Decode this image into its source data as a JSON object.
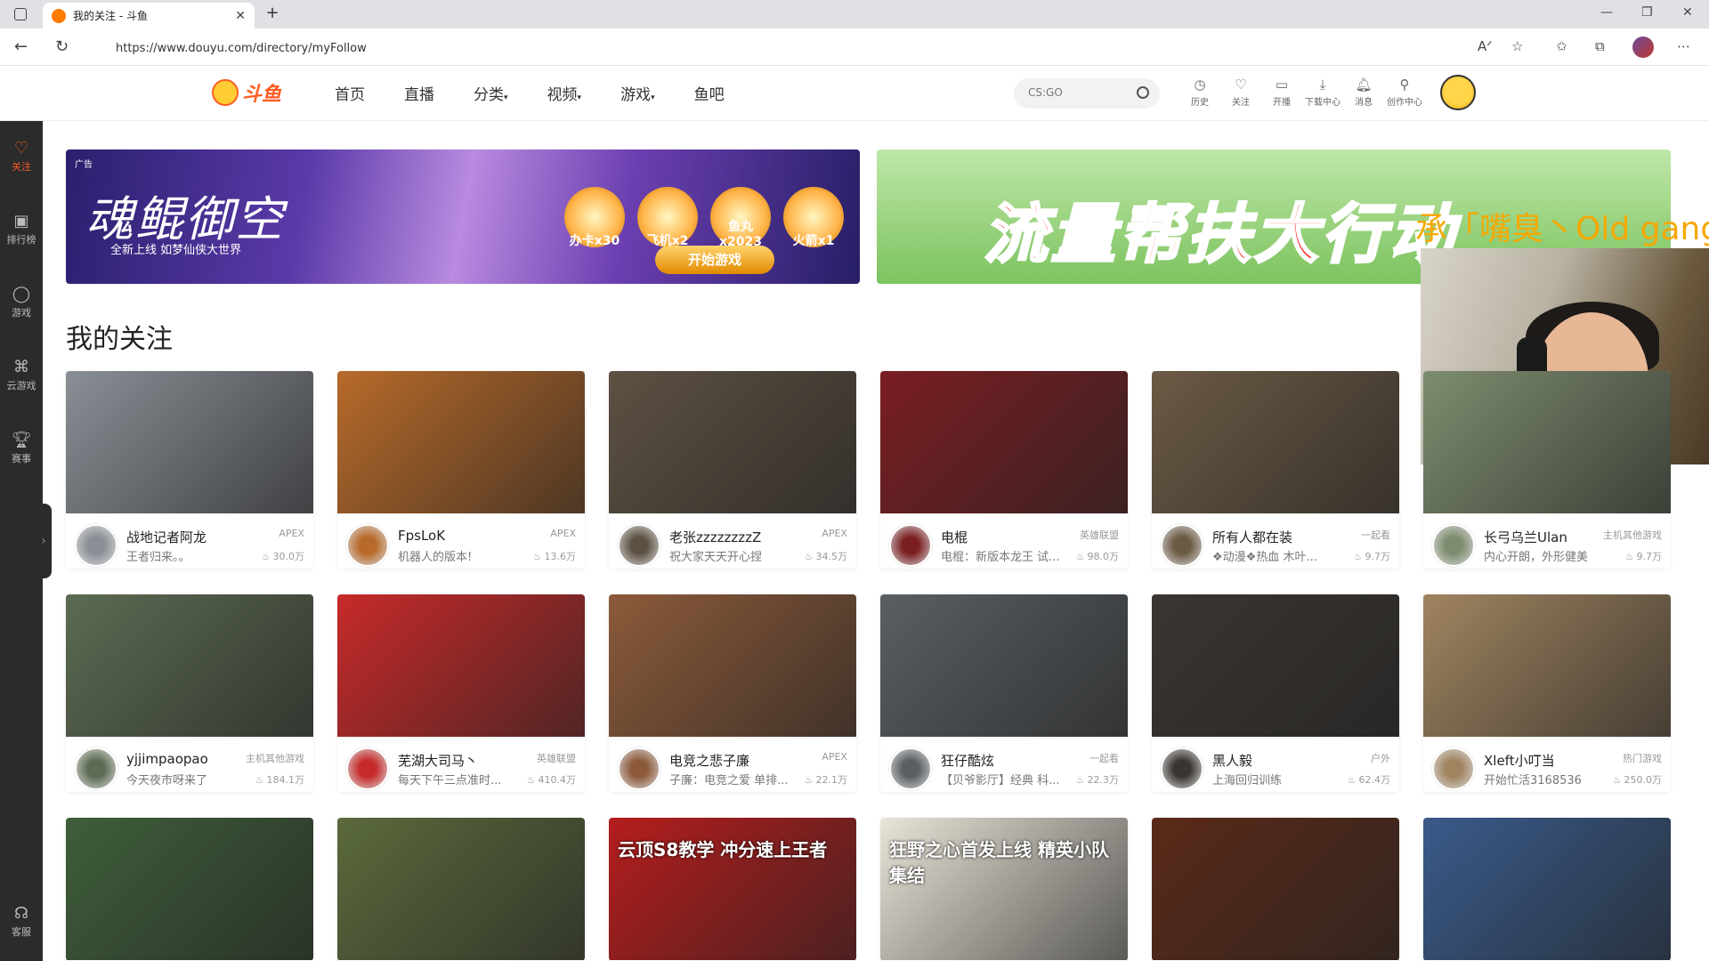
{
  "browser": {
    "tab_title": "我的关注 - 斗鱼",
    "new_tab": "+",
    "url": "https://www.douyu.com/directory/myFollow",
    "window_min": "—",
    "window_max": "❐",
    "window_close": "✕"
  },
  "header": {
    "logo_text": "斗鱼",
    "nav": [
      "首页",
      "直播",
      "分类",
      "视频",
      "游戏",
      "鱼吧"
    ],
    "search_placeholder": "CS:GO",
    "tools": [
      {
        "label": "历史",
        "icon": "history-icon"
      },
      {
        "label": "关注",
        "icon": "heart-icon"
      },
      {
        "label": "开播",
        "icon": "broadcast-icon"
      },
      {
        "label": "下载中心",
        "icon": "download-icon"
      },
      {
        "label": "消息",
        "icon": "bell-icon"
      },
      {
        "label": "创作中心",
        "icon": "creator-icon"
      }
    ]
  },
  "sidebar": {
    "items": [
      {
        "label": "关注",
        "icon": "heart-icon",
        "active": true
      },
      {
        "label": "排行榜",
        "icon": "ranking-icon",
        "active": false
      },
      {
        "label": "游戏",
        "icon": "game-icon",
        "active": false
      },
      {
        "label": "云游戏",
        "icon": "cloud-game-icon",
        "active": false
      },
      {
        "label": "赛事",
        "icon": "trophy-icon",
        "active": false
      },
      {
        "label": "客服",
        "icon": "headset-icon",
        "active": false
      }
    ],
    "collapse": "›"
  },
  "banners": {
    "left": {
      "ad_tag": "广告",
      "title": "魂鲲御空",
      "subtitle": "全新上线 如梦仙侠大世界",
      "rewards": [
        "办卡x30",
        "飞机x2",
        "鱼丸x2023",
        "火箭x1"
      ],
      "cta": "开始游戏"
    },
    "right": {
      "title": "流量帮扶大行动"
    }
  },
  "stream_overlay": "承「嘴臭丶Old gang",
  "section_title": "我的关注",
  "cards": [
    {
      "name": "战地记者阿龙",
      "category": "APEX",
      "desc": "王者归来。。",
      "heat": "30.0万",
      "color": "#8a8f96"
    },
    {
      "name": "FpsLoK",
      "category": "APEX",
      "desc": "机器人的版本!",
      "heat": "13.6万",
      "color": "#b86a2a"
    },
    {
      "name": "老张zzzzzzzzZ",
      "category": "APEX",
      "desc": "祝大家天天开心捏",
      "heat": "34.5万",
      "color": "#5d5142"
    },
    {
      "name": "电棍",
      "category": "英雄联盟",
      "desc": "电棍：新版本龙王 试...",
      "heat": "98.0万",
      "color": "#7a1e22"
    },
    {
      "name": "所有人都在装",
      "category": "一起看",
      "desc": "❖动漫❖热血 木叶...",
      "heat": "9.7万",
      "color": "#6b5a44"
    },
    {
      "name": "长弓乌兰Ulan",
      "category": "主机其他游戏",
      "desc": "内心开朗，外形健美",
      "heat": "9.7万",
      "color": "#7d8c6e"
    },
    {
      "name": "yjjimpaopao",
      "category": "主机其他游戏",
      "desc": "今天夜市呀来了",
      "heat": "184.1万",
      "color": "#5c6b52"
    },
    {
      "name": "芜湖大司马丶",
      "category": "英雄联盟",
      "desc": "每天下午三点准时...",
      "heat": "410.4万",
      "color": "#c72a2a"
    },
    {
      "name": "电竞之悲子廉",
      "category": "APEX",
      "desc": "子廉：电竞之爱 单排...",
      "heat": "22.1万",
      "color": "#8c5a3a"
    },
    {
      "name": "狂仔酷炫",
      "category": "一起看",
      "desc": "【贝爷影厅】经典 科...",
      "heat": "22.3万",
      "color": "#5a5f63"
    },
    {
      "name": "黑人毅",
      "category": "户外",
      "desc": "上海回归训练",
      "heat": "62.4万",
      "color": "#3a3530"
    },
    {
      "name": "Xleft小叮当",
      "category": "热门游戏",
      "desc": "开始忙活3168536",
      "heat": "250.0万",
      "color": "#a08460"
    },
    {
      "name": "",
      "category": "",
      "desc": "",
      "heat": "",
      "color": "#3f5e3a",
      "partial": true
    },
    {
      "name": "",
      "category": "",
      "desc": "",
      "heat": "",
      "color": "#5b6a3c",
      "partial": true
    },
    {
      "name": "",
      "category": "",
      "desc": "",
      "heat": "",
      "color": "#b51d1d",
      "partial": true,
      "overlay_text": "云顶S8教学 冲分速上王者"
    },
    {
      "name": "",
      "category": "",
      "desc": "",
      "heat": "",
      "color": "#e9e4d8",
      "partial": true,
      "overlay_text": "狂野之心首发上线 精英小队集结"
    },
    {
      "name": "",
      "category": "",
      "desc": "",
      "heat": "",
      "color": "#5a2a18",
      "partial": true
    },
    {
      "name": "",
      "category": "",
      "desc": "",
      "heat": "",
      "color": "#3a5a8a",
      "partial": true
    }
  ]
}
